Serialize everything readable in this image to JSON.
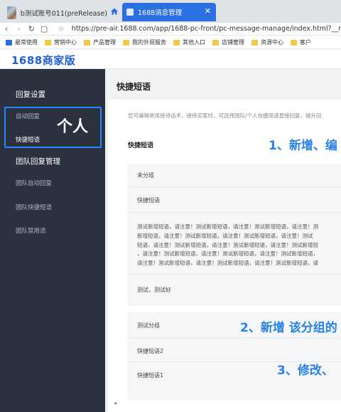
{
  "browser": {
    "tabs": [
      {
        "title": "b测试账号011(preRelease)"
      },
      {
        "title": "1688消息管理"
      }
    ],
    "url": "https://pre-air.1688.com/app/1688-pc-front/pc-message-manage/index.html?__m",
    "bookmarks": [
      "最常使用",
      "营销中心",
      "产品管理",
      "我的外贸服务",
      "其他入口",
      "店铺管理",
      "资源中心",
      "客户"
    ]
  },
  "app": {
    "logo": "1688商家版"
  },
  "sidebar": {
    "group1": "回复设置",
    "group1_items": [
      "自动回复",
      "快捷短语"
    ],
    "group2": "团队回复管理",
    "group2_items": [
      "团队自动回复",
      "团队快捷短语",
      "团队禁用语"
    ],
    "highlight_label": "个人"
  },
  "main": {
    "title": "快捷短语",
    "description": "您可编辑常用接待话术，接待买家时，可选择团队/个人快捷用语直接回复，提升回",
    "section_title": "快捷短语",
    "annotation_1": "1、新增、编",
    "group_a": {
      "name": "未分组",
      "items": [
        "快捷短语"
      ],
      "long_text": [
        "测试新增短语，请注意！测试新增短语，请注意！测试新增短语，请注意！测",
        "新增短语，请注意！测试新增短语，请注意！测试新增短语，请注意！测试",
        "短语，请注意！测试新增短语，请注意！测试新增短语，请注意！测试新增短",
        "，请注意！测试新增短语，请注意！测试新增短语，请注意！测试新增短语，",
        "请注意！测试新增短语，请注意！测试新增短语，请注意！测试新增短语，请"
      ],
      "extra": "测试，测试好"
    },
    "group_b": {
      "name": "测试分组",
      "items": [
        "快捷短语2",
        "快捷短语1"
      ]
    },
    "annotation_2": "2、新增 该分组的",
    "annotation_3": "3、修改、"
  },
  "colors": {
    "accent": "#2b6fe0",
    "sidebar": "#2b313e",
    "annotation": "#2a82e4"
  }
}
